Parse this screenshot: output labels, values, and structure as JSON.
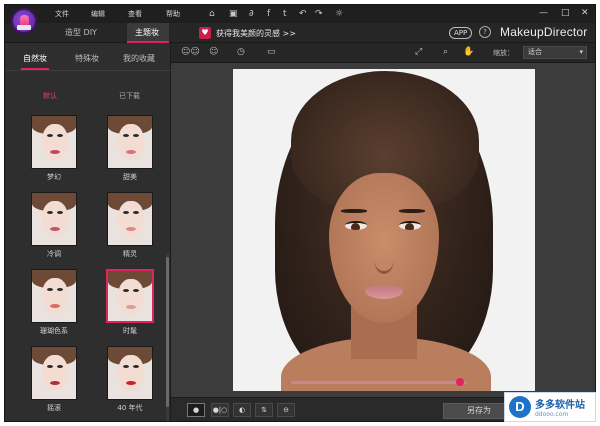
{
  "menu": {
    "items": [
      "文件",
      "编辑",
      "查看",
      "帮助"
    ]
  },
  "titlebar_icons": [
    "home-icon",
    "save-icon",
    "share-icon",
    "facebook-icon",
    "twitter-icon",
    "undo-icon",
    "redo-icon",
    "settings-icon"
  ],
  "titlebar_glyphs": {
    "home": "⌂",
    "save": "▣",
    "share": "∂",
    "facebook": "f",
    "twitter": "t",
    "undo": "↶",
    "redo": "↷",
    "settings": "☼",
    "minimize": "—",
    "maximize": "□",
    "close": "✕"
  },
  "window_controls": {
    "minimize": "—",
    "maximize": "□",
    "close": "✕"
  },
  "mode_tabs": [
    {
      "label": "造型 DIY",
      "active": false
    },
    {
      "label": "主题妆",
      "active": true
    }
  ],
  "promo": {
    "icon": "♥",
    "text": "获得我美颜的灵感 >>"
  },
  "app_badge": "APP",
  "help_glyph": "?",
  "brand": "MakeupDirector",
  "left_panel": {
    "category_tabs": [
      {
        "label": "自然妆",
        "active": true
      },
      {
        "label": "特殊妆",
        "active": false
      },
      {
        "label": "我的收藏",
        "active": false
      }
    ],
    "filters": [
      {
        "label": "默认",
        "active": true
      },
      {
        "label": "已下载",
        "active": false
      }
    ],
    "looks": [
      {
        "label": "梦幻",
        "lip": "#c2456a",
        "selected": false
      },
      {
        "label": "甜美",
        "lip": "#d76f8a",
        "selected": false
      },
      {
        "label": "冷调",
        "lip": "#b85a70",
        "selected": false
      },
      {
        "label": "精灵",
        "lip": "#d98a8e",
        "selected": false
      },
      {
        "label": "珊瑚色系",
        "lip": "#e06a6a",
        "selected": false
      },
      {
        "label": "时髦",
        "lip": "#d3a0a0",
        "selected": true
      },
      {
        "label": "摇滚",
        "lip": "#b03040",
        "selected": false
      },
      {
        "label": "40 年代",
        "lip": "#c8202f",
        "selected": false
      }
    ]
  },
  "toolbar": {
    "icons": [
      "compare-faces-icon",
      "face-outline-icon",
      "history-icon",
      "display-icon",
      "fit-screen-icon",
      "zoom-icon",
      "hand-tool-icon"
    ],
    "glyphs": {
      "compare": "☺☺",
      "face": "☺",
      "history": "◷",
      "display": "▭",
      "fit": "⤢",
      "zoom": "⌕",
      "hand": "✋"
    },
    "zoom_label": "缩放：",
    "zoom_value": "适合",
    "zoom_arrow": "▾"
  },
  "compare_slider": {
    "value": 0.96
  },
  "bottombar": {
    "view_buttons": [
      {
        "name": "single-view-button",
        "glyph": "●",
        "active": true
      },
      {
        "name": "before-after-button",
        "glyph": "●|○",
        "active": false
      },
      {
        "name": "split-view-button",
        "glyph": "◐",
        "active": false
      },
      {
        "name": "vertical-split-button",
        "glyph": "⇅",
        "active": false
      },
      {
        "name": "horizontal-split-button",
        "glyph": "⊖",
        "active": false
      }
    ],
    "save_as": "另存为"
  },
  "watermark": {
    "logo": "D",
    "name": "多多软件站",
    "url": "ddooo.com"
  },
  "colors": {
    "accent": "#e0245e",
    "background": "#2b2b2b",
    "panel": "#2e2e2e",
    "canvas": "#3c3c3c"
  }
}
